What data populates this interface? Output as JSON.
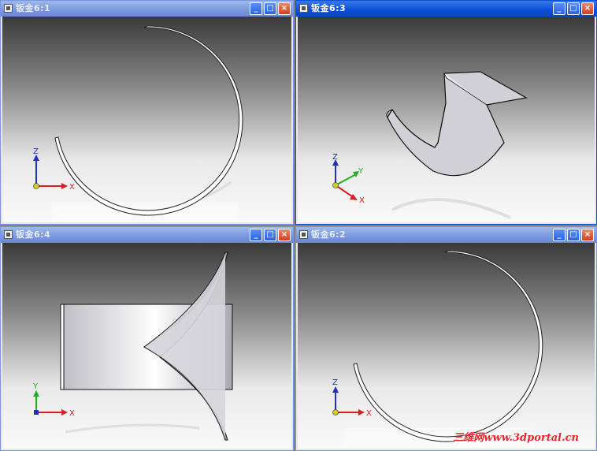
{
  "windows": {
    "w1": {
      "title": "钣金6:1"
    },
    "w3": {
      "title": "钣金6:3"
    },
    "w4": {
      "title": "钣金6:4"
    },
    "w2": {
      "title": "钣金6:2"
    }
  },
  "buttons": {
    "minimize": "_",
    "maximize": "□",
    "close": "×"
  },
  "axes": {
    "x": "X",
    "y": "Y",
    "z": "Z"
  },
  "watermark": "三维网www.3dportal.cn",
  "colors": {
    "active_title": "#0a4fd6",
    "inactive_title": "#7a96df",
    "axis_x": "#d42020",
    "axis_y": "#20b020",
    "axis_z": "#2030c0"
  }
}
